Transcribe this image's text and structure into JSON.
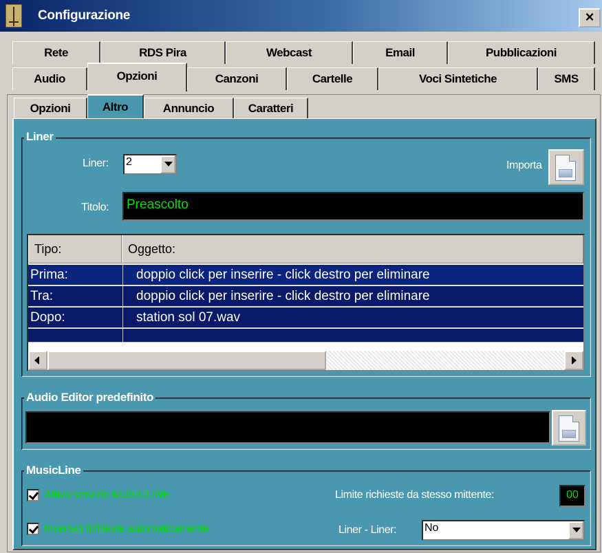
{
  "window": {
    "title": "Configurazione",
    "close_label": "×"
  },
  "tabs": {
    "row1": [
      "Rete",
      "RDS Pira",
      "Webcast",
      "Email",
      "Pubblicazioni"
    ],
    "row2": [
      "Audio",
      "Opzioni",
      "Canzoni",
      "Cartelle",
      "Voci Sintetiche",
      "SMS"
    ],
    "active": "Opzioni"
  },
  "subtabs": {
    "items": [
      "Opzioni",
      "Altro",
      "Annuncio",
      "Caratteri"
    ],
    "active": "Altro"
  },
  "liner": {
    "legend": "Liner",
    "liner_label": "Liner:",
    "liner_value": "2",
    "importa_label": "Importa",
    "titolo_label": "Titolo:",
    "titolo_value": "Preascolto",
    "grid": {
      "columns": [
        "Tipo:",
        "Oggetto:"
      ],
      "rows": [
        {
          "tipo": "Prima:",
          "oggetto": "doppio click per inserire - click destro per eliminare"
        },
        {
          "tipo": "Tra:",
          "oggetto": "doppio click per inserire - click destro per eliminare"
        },
        {
          "tipo": "Dopo:",
          "oggetto": "station sol 07.wav"
        }
      ]
    }
  },
  "audio_editor": {
    "legend": "Audio Editor predefinito",
    "value": ""
  },
  "musicline": {
    "legend": "MusicLine",
    "attiva_label": "Attiva servizio MUSICLINE",
    "attiva_checked": true,
    "inserisci_label": "Inserisci richieste automaticamente",
    "inserisci_checked": true,
    "limite_label": "Limite richieste da stesso mittente:",
    "limite_value": "00",
    "liner_liner_label": "Liner - Liner:",
    "liner_liner_value": "No"
  },
  "colors": {
    "panel": "#4a98b0",
    "grid_row": "#0a1a6a",
    "grid_row_selected": "#0a2480",
    "text_green": "#00e000"
  }
}
